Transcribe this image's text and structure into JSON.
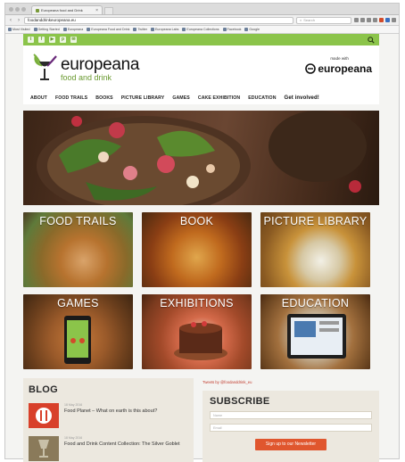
{
  "browser": {
    "tab_title": "Europeana food and Drink",
    "address": "foodanddrinkeuropeana.eu",
    "search_placeholder": "Search",
    "bookmarks": [
      "Most Visited",
      "Getting Started",
      "Europeana",
      "Europeana Food and Drink",
      "Twitter",
      "Europeana Labs",
      "Europeana Collections",
      "Facebook",
      "Google"
    ]
  },
  "header": {
    "social_icons": [
      "twitter-icon",
      "facebook-icon",
      "youtube-icon",
      "pinterest-icon",
      "email-icon"
    ],
    "social_glyphs": [
      "t",
      "f",
      "▶",
      "p",
      "✉"
    ],
    "logo_title": "europeana",
    "logo_subtitle": "food and drink",
    "made_with_small": "made with",
    "made_with_brand": "europeana"
  },
  "nav": {
    "items": [
      "ABOUT",
      "FOOD TRAILS",
      "BOOKS",
      "PICTURE LIBRARY",
      "GAMES",
      "CAKE EXHIBITION",
      "EDUCATION",
      "Get involved!"
    ]
  },
  "tiles": [
    "FOOD TRAILS",
    "BOOK",
    "PICTURE LIBRARY",
    "GAMES",
    "EXHIBITIONS",
    "EDUCATION"
  ],
  "blog": {
    "title": "BLOG",
    "posts": [
      {
        "date": "18 May 2016",
        "title": "Food Planet – What on earth is this about?"
      },
      {
        "date": "18 May 2016",
        "title": "Food and Drink Content Collection: The Silver Goblet"
      }
    ]
  },
  "tweets": {
    "label": "Tweets by @foodanddrink_eu"
  },
  "subscribe": {
    "title": "SUBSCRIBE",
    "name_placeholder": "Name",
    "email_placeholder": "Email",
    "button_label": "Sign up to our Newsletter"
  },
  "colors": {
    "brand_green": "#8bc44a",
    "button_orange": "#e0562e"
  }
}
